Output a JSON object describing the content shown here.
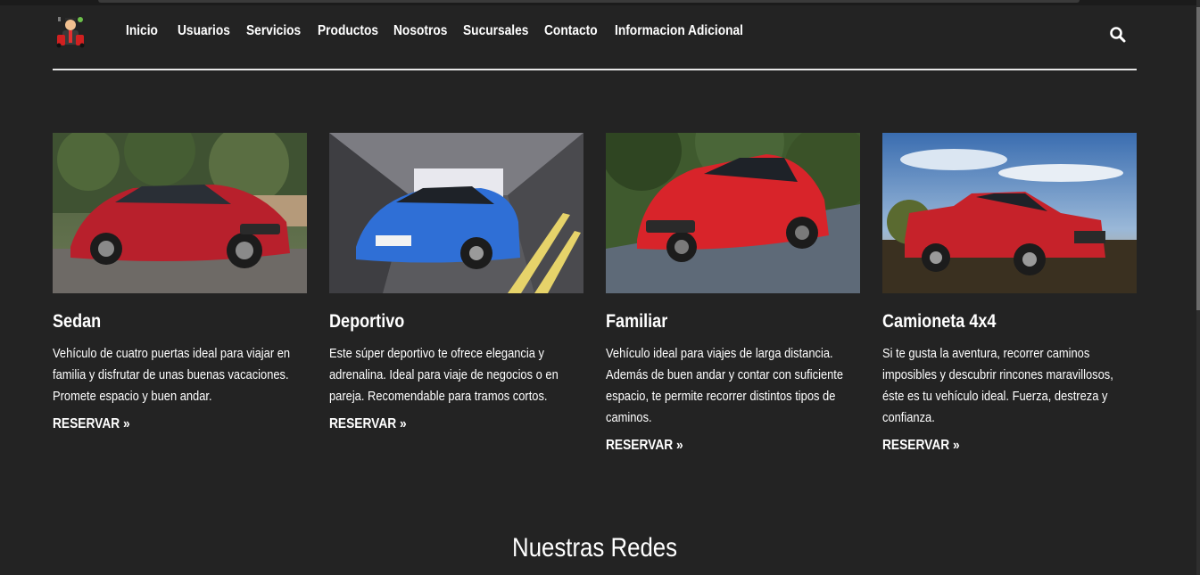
{
  "nav": {
    "logo_name": "car-dealer-logo",
    "links": [
      "Inicio",
      "Usuarios",
      "Servicios",
      "Productos",
      "Nosotros",
      "Sucursales",
      "Contacto",
      "Informacion Adicional"
    ],
    "search_icon": "search-icon"
  },
  "cards": [
    {
      "title": "Sedan",
      "description": "Vehículo de cuatro puertas ideal para viajar en familia y disfrutar de unas buenas vacaciones. Promete espacio y buen andar.",
      "link": "RESERVAR »",
      "car_color": "#b8202c"
    },
    {
      "title": "Deportivo",
      "description": "Este súper deportivo te ofrece elegancia y adrenalina. Ideal para viaje de negocios o en pareja. Recomendable para tramos cortos.",
      "link": "RESERVAR »",
      "car_color": "#2f6fd6"
    },
    {
      "title": "Familiar",
      "description": "Vehículo ideal para viajes de larga distancia. Además de buen andar y contar con suficiente espacio, te permite recorrer distintos tipos de caminos.",
      "link": "RESERVAR »",
      "car_color": "#d8242a"
    },
    {
      "title": "Camioneta 4x4",
      "description": "Si te gusta la aventura, recorrer caminos imposibles y descubrir rincones maravillosos, éste es tu vehículo ideal. Fuerza, destreza y confianza.",
      "link": "RESERVAR »",
      "car_color": "#c6222a"
    }
  ],
  "section": {
    "title": "Nuestras Redes"
  },
  "colors": {
    "background": "#232323",
    "text": "#ffffff"
  }
}
